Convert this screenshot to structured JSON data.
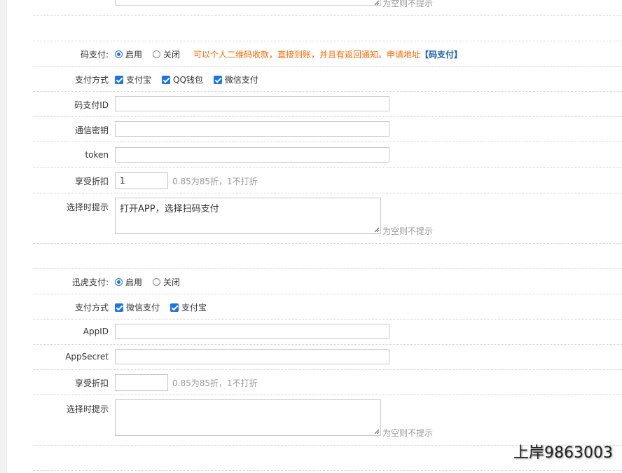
{
  "common": {
    "enable": "启用",
    "disable": "关闭",
    "empty_no_hint": "为空则不提示",
    "discount_hint": "0.85为85折，1不打折"
  },
  "code_pay": {
    "label": "码支付:",
    "notice": "可以个人二维码收款，直接到账，并且有返回通知。申请地址",
    "notice_link": "【码支付】",
    "pay_method_label": "支付方式",
    "methods": [
      "支付宝",
      "QQ钱包",
      "微信支付"
    ],
    "id_label": "码支付ID",
    "id_value": "",
    "key_label": "通信密钥",
    "key_value": "",
    "token_label": "token",
    "token_value": "",
    "discount_label": "享受折扣",
    "discount_value": "1",
    "prompt_label": "选择时提示",
    "prompt_value": "打开APP，选择扫码支付"
  },
  "xunhu_pay": {
    "label": "迅虎支付:",
    "pay_method_label": "支付方式",
    "methods": [
      "微信支付",
      "支付宝"
    ],
    "appid_label": "AppID",
    "appid_value": "",
    "appsecret_label": "AppSecret",
    "appsecret_value": "",
    "discount_label": "享受折扣",
    "discount_value": "",
    "prompt_label": "选择时提示",
    "prompt_value": ""
  },
  "watermark": "上岸9863003",
  "colors": {
    "accent": "#1a73e8",
    "notice": "#ff6a00",
    "link": "#1a5fb4"
  }
}
